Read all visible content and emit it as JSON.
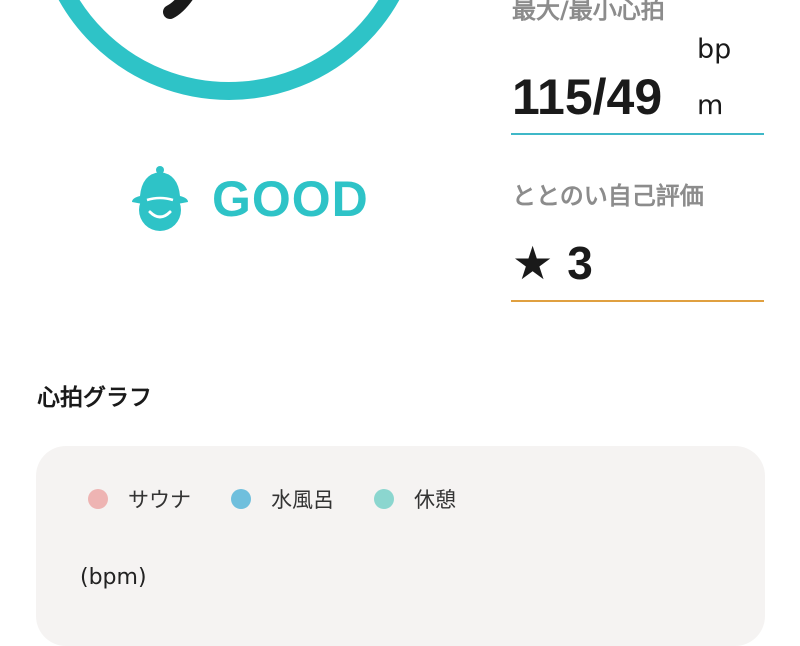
{
  "status": {
    "label": "GOOD",
    "accent": "#2ec3c7"
  },
  "heart_rate": {
    "label": "最大/最小心拍",
    "value": "115/49",
    "unit_line1": "bp",
    "unit_line2": "m",
    "underline_color": "#3fb8c8"
  },
  "self_rating": {
    "label": "ととのい自己評価",
    "star": "★",
    "value": "3",
    "underline_color": "#e0a040"
  },
  "graph": {
    "title": "心拍グラフ",
    "legend": [
      {
        "label": "サウナ",
        "color": "#eeb4b3"
      },
      {
        "label": "水風呂",
        "color": "#6fbfdd"
      },
      {
        "label": "休憩",
        "color": "#8bd6cf"
      }
    ],
    "y_unit": "(bpm)"
  }
}
